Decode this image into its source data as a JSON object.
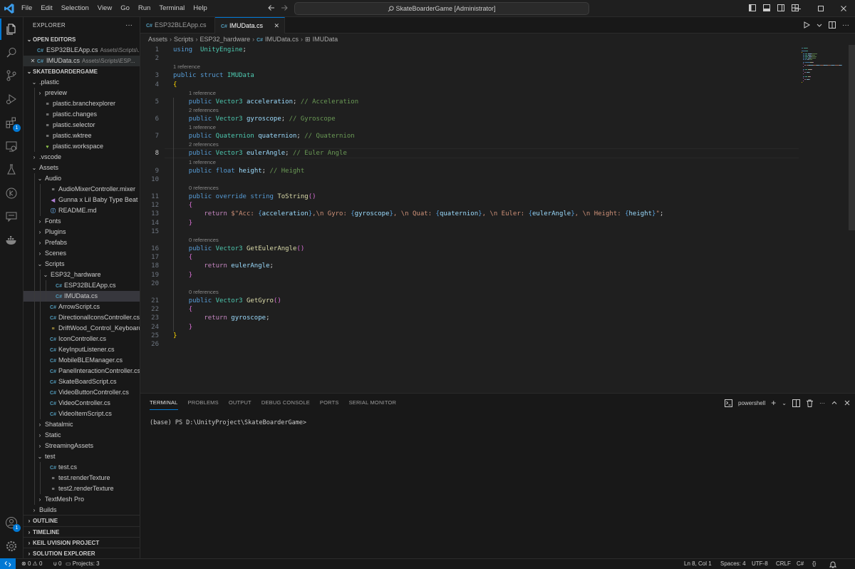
{
  "menu": [
    "File",
    "Edit",
    "Selection",
    "View",
    "Go",
    "Run",
    "Terminal",
    "Help"
  ],
  "command_center": "SkateBoarderGame [Administrator]",
  "activity_badges": {
    "extensions": "1",
    "accounts": "1"
  },
  "sidebar": {
    "title": "EXPLORER",
    "open_editors_label": "OPEN EDITORS",
    "open_editors": [
      {
        "name": "ESP32BLEApp.cs",
        "desc": "Assets\\Scripts\\...",
        "active": false
      },
      {
        "name": "IMUData.cs",
        "desc": "Assets\\Scripts\\ESP...",
        "active": true
      }
    ],
    "project_label": "SKATEBOARDERGAME",
    "tree": [
      {
        "d": 0,
        "t": "folder-open",
        "name": ".plastic"
      },
      {
        "d": 1,
        "t": "folder",
        "name": "preview"
      },
      {
        "d": 1,
        "t": "doc",
        "name": "plastic.branchexplorer"
      },
      {
        "d": 1,
        "t": "doc",
        "name": "plastic.changes"
      },
      {
        "d": 1,
        "t": "doc",
        "name": "plastic.selector"
      },
      {
        "d": 1,
        "t": "doc",
        "name": "plastic.wktree"
      },
      {
        "d": 1,
        "t": "heart",
        "name": "plastic.workspace"
      },
      {
        "d": 0,
        "t": "folder",
        "name": ".vscode"
      },
      {
        "d": 0,
        "t": "folder-open",
        "name": "Assets"
      },
      {
        "d": 1,
        "t": "folder-open",
        "name": "Audio"
      },
      {
        "d": 2,
        "t": "doc",
        "name": "AudioMixerController.mixer"
      },
      {
        "d": 2,
        "t": "audio",
        "name": "Gunna x Lil Baby Type Beat MP..."
      },
      {
        "d": 2,
        "t": "info",
        "name": "README.md"
      },
      {
        "d": 1,
        "t": "folder",
        "name": "Fonts"
      },
      {
        "d": 1,
        "t": "folder",
        "name": "Plugins"
      },
      {
        "d": 1,
        "t": "folder",
        "name": "Prefabs"
      },
      {
        "d": 1,
        "t": "folder",
        "name": "Scenes"
      },
      {
        "d": 1,
        "t": "folder-open",
        "name": "Scripts"
      },
      {
        "d": 2,
        "t": "folder-open",
        "name": "ESP32_hardware"
      },
      {
        "d": 3,
        "t": "cs",
        "name": "ESP32BLEApp.cs"
      },
      {
        "d": 3,
        "t": "cs",
        "name": "IMUData.cs",
        "selected": true
      },
      {
        "d": 2,
        "t": "cs",
        "name": "ArrowScript.cs"
      },
      {
        "d": 2,
        "t": "cs",
        "name": "DirectionalIconsController.cs"
      },
      {
        "d": 2,
        "t": "py",
        "name": "DriftWood_Control_Keyboard.py"
      },
      {
        "d": 2,
        "t": "cs",
        "name": "IconController.cs"
      },
      {
        "d": 2,
        "t": "cs",
        "name": "KeyInputListener.cs"
      },
      {
        "d": 2,
        "t": "cs",
        "name": "MobileBLEManager.cs"
      },
      {
        "d": 2,
        "t": "cs",
        "name": "PanelInteractionController.cs"
      },
      {
        "d": 2,
        "t": "cs",
        "name": "SkateBoardScript.cs"
      },
      {
        "d": 2,
        "t": "cs",
        "name": "VideoButtonController.cs"
      },
      {
        "d": 2,
        "t": "cs",
        "name": "VideoController.cs"
      },
      {
        "d": 2,
        "t": "cs",
        "name": "VideoItemScript.cs"
      },
      {
        "d": 1,
        "t": "folder",
        "name": "Shatalmic"
      },
      {
        "d": 1,
        "t": "folder",
        "name": "Static"
      },
      {
        "d": 1,
        "t": "folder",
        "name": "StreamingAssets"
      },
      {
        "d": 1,
        "t": "folder-open",
        "name": "test"
      },
      {
        "d": 2,
        "t": "cs",
        "name": "test.cs"
      },
      {
        "d": 2,
        "t": "doc",
        "name": "test.renderTexture"
      },
      {
        "d": 2,
        "t": "doc",
        "name": "test2.renderTexture"
      },
      {
        "d": 1,
        "t": "folder",
        "name": "TextMesh Pro"
      },
      {
        "d": 0,
        "t": "folder",
        "name": "Builds"
      }
    ],
    "bottom_sections": [
      "OUTLINE",
      "TIMELINE",
      "KEIL UVISION PROJECT",
      "SOLUTION EXPLORER"
    ]
  },
  "tabs": [
    {
      "label": "ESP32BLEApp.cs"
    },
    {
      "label": "IMUData.cs"
    }
  ],
  "breadcrumbs": [
    "Assets",
    "Scripts",
    "ESP32_hardware",
    "IMUData.cs",
    "IMUData"
  ],
  "editor": {
    "current_line": 8,
    "lines": [
      [
        [
          "kw",
          "using"
        ],
        [
          "",
          "  "
        ],
        [
          "ty",
          "UnityEngine"
        ],
        [
          "",
          ";"
        ]
      ],
      [],
      [
        [
          "kw",
          "public"
        ],
        [
          "",
          " "
        ],
        [
          "kw",
          "struct"
        ],
        [
          "",
          " "
        ],
        [
          "ty",
          "IMUData"
        ]
      ],
      [
        [
          "br1",
          "{"
        ]
      ],
      [
        [
          "",
          "    "
        ],
        [
          "kw",
          "public"
        ],
        [
          "",
          " "
        ],
        [
          "ty",
          "Vector3"
        ],
        [
          "",
          " "
        ],
        [
          "vr",
          "acceleration"
        ],
        [
          "",
          "; "
        ],
        [
          "cm",
          "// Acceleration"
        ]
      ],
      [
        [
          "",
          "    "
        ],
        [
          "kw",
          "public"
        ],
        [
          "",
          " "
        ],
        [
          "ty",
          "Vector3"
        ],
        [
          "",
          " "
        ],
        [
          "vr",
          "gyroscope"
        ],
        [
          "",
          "; "
        ],
        [
          "cm",
          "// Gyroscope"
        ]
      ],
      [
        [
          "",
          "    "
        ],
        [
          "kw",
          "public"
        ],
        [
          "",
          " "
        ],
        [
          "ty",
          "Quaternion"
        ],
        [
          "",
          " "
        ],
        [
          "vr",
          "quaternion"
        ],
        [
          "",
          "; "
        ],
        [
          "cm",
          "// Quaternion"
        ]
      ],
      [
        [
          "",
          "    "
        ],
        [
          "kw",
          "public"
        ],
        [
          "",
          " "
        ],
        [
          "ty",
          "Vector3"
        ],
        [
          "",
          " "
        ],
        [
          "vr",
          "eulerAngle"
        ],
        [
          "",
          "; "
        ],
        [
          "cm",
          "// Euler Angle"
        ]
      ],
      [
        [
          "",
          "    "
        ],
        [
          "kw",
          "public"
        ],
        [
          "",
          " "
        ],
        [
          "kw",
          "float"
        ],
        [
          "",
          " "
        ],
        [
          "vr",
          "height"
        ],
        [
          "",
          "; "
        ],
        [
          "cm",
          "// Height"
        ]
      ],
      [],
      [
        [
          "",
          "    "
        ],
        [
          "kw",
          "public"
        ],
        [
          "",
          " "
        ],
        [
          "kw",
          "override"
        ],
        [
          "",
          " "
        ],
        [
          "kw",
          "string"
        ],
        [
          "",
          " "
        ],
        [
          "fn",
          "ToString"
        ],
        [
          "br2",
          "()"
        ]
      ],
      [
        [
          "",
          "    "
        ],
        [
          "br2",
          "{"
        ]
      ],
      [
        [
          "",
          "        "
        ],
        [
          "ct",
          "return"
        ],
        [
          "",
          " "
        ],
        [
          "st",
          "$\"Acc: "
        ],
        [
          "kw",
          "{"
        ],
        [
          "vr",
          "acceleration"
        ],
        [
          "kw",
          "}"
        ],
        [
          "st",
          ",\\n Gyro: "
        ],
        [
          "kw",
          "{"
        ],
        [
          "vr",
          "gyroscope"
        ],
        [
          "kw",
          "}"
        ],
        [
          "st",
          ", \\n Quat: "
        ],
        [
          "kw",
          "{"
        ],
        [
          "vr",
          "quaternion"
        ],
        [
          "kw",
          "}"
        ],
        [
          "st",
          ", \\n Euler: "
        ],
        [
          "kw",
          "{"
        ],
        [
          "vr",
          "eulerAngle"
        ],
        [
          "kw",
          "}"
        ],
        [
          "st",
          ", \\n Height: "
        ],
        [
          "kw",
          "{"
        ],
        [
          "vr",
          "height"
        ],
        [
          "kw",
          "}"
        ],
        [
          "st",
          "\""
        ],
        [
          "",
          ";"
        ]
      ],
      [
        [
          "",
          "    "
        ],
        [
          "br2",
          "}"
        ]
      ],
      [],
      [
        [
          "",
          "    "
        ],
        [
          "kw",
          "public"
        ],
        [
          "",
          " "
        ],
        [
          "ty",
          "Vector3"
        ],
        [
          "",
          " "
        ],
        [
          "fn",
          "GetEulerAngle"
        ],
        [
          "br2",
          "()"
        ]
      ],
      [
        [
          "",
          "    "
        ],
        [
          "br2",
          "{"
        ]
      ],
      [
        [
          "",
          "        "
        ],
        [
          "ct",
          "return"
        ],
        [
          "",
          " "
        ],
        [
          "vr",
          "eulerAngle"
        ],
        [
          "",
          ";"
        ]
      ],
      [
        [
          "",
          "    "
        ],
        [
          "br2",
          "}"
        ]
      ],
      [],
      [
        [
          "",
          "    "
        ],
        [
          "kw",
          "public"
        ],
        [
          "",
          " "
        ],
        [
          "ty",
          "Vector3"
        ],
        [
          "",
          " "
        ],
        [
          "fn",
          "GetGyro"
        ],
        [
          "br2",
          "()"
        ]
      ],
      [
        [
          "",
          "    "
        ],
        [
          "br2",
          "{"
        ]
      ],
      [
        [
          "",
          "        "
        ],
        [
          "ct",
          "return"
        ],
        [
          "",
          " "
        ],
        [
          "vr",
          "gyroscope"
        ],
        [
          "",
          ";"
        ]
      ],
      [
        [
          "",
          "    "
        ],
        [
          "br2",
          "}"
        ]
      ],
      [
        [
          "br1",
          "}"
        ]
      ],
      []
    ],
    "lenses": [
      {
        "before": 3,
        "text": "1 reference",
        "indent": 0
      },
      {
        "before": 5,
        "text": "1 reference",
        "indent": 1
      },
      {
        "before": 6,
        "text": "2 references",
        "indent": 1
      },
      {
        "before": 7,
        "text": "1 reference",
        "indent": 1
      },
      {
        "before": 8,
        "text": "2 references",
        "indent": 1
      },
      {
        "before": 9,
        "text": "1 reference",
        "indent": 1
      },
      {
        "before": 11,
        "text": "0 references",
        "indent": 1
      },
      {
        "before": 16,
        "text": "0 references",
        "indent": 1
      },
      {
        "before": 21,
        "text": "0 references",
        "indent": 1
      }
    ]
  },
  "panel": {
    "tabs": [
      "TERMINAL",
      "PROBLEMS",
      "OUTPUT",
      "DEBUG CONSOLE",
      "PORTS",
      "SERIAL MONITOR"
    ],
    "active_tab": "TERMINAL",
    "shell": "powershell",
    "terminal_line": "(base) PS D:\\UnityProject\\SkateBoarderGame>"
  },
  "statusbar": {
    "errors": "0",
    "warnings": "0",
    "ports": "0",
    "projects": "Projects: 3",
    "position": "Ln 8, Col 1",
    "spaces": "Spaces: 4",
    "encoding": "UTF-8",
    "eol": "CRLF",
    "language": "C#"
  },
  "colors": {
    "accent": "#0078d4",
    "editor_bg": "#1f1f1f",
    "sidebar_bg": "#181818"
  }
}
